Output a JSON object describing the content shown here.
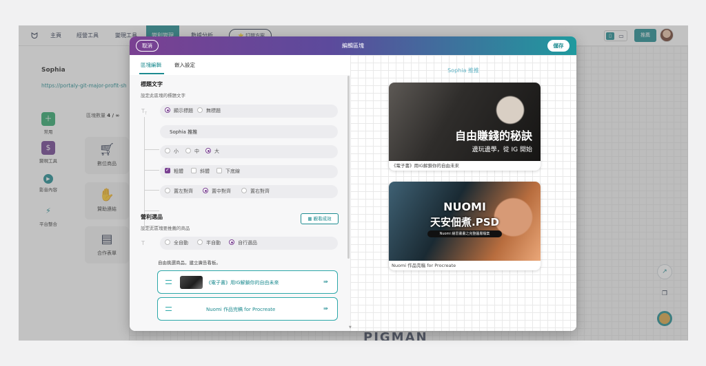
{
  "app": {
    "nav": [
      "主頁",
      "經營工具",
      "變現工具",
      "變利變現",
      "數據分析"
    ],
    "nav_active_index": 3,
    "nav_extra_button": "⭐ 訂閱方案",
    "publish_label": "推薦",
    "colors": {
      "accent": "#1b8a8f",
      "header_start": "#7a4192",
      "header_end": "#1f9a9e"
    }
  },
  "side": {
    "name": "Sophia",
    "link": "https://portaly-git-major-profit-sh",
    "block_count_label": "區塊數量",
    "block_count_value": "4 / ∞",
    "rail": [
      {
        "label": "常用",
        "icon": "plus-icon"
      },
      {
        "label": "變現工具",
        "icon": "dollar-icon"
      },
      {
        "label": "影音內容",
        "icon": "play-icon"
      },
      {
        "label": "平台整合",
        "icon": "bolt-icon"
      }
    ],
    "tiles": [
      {
        "label": "數位商品",
        "icon": "cart-icon"
      },
      {
        "label": "贊助連結",
        "icon": "donate-icon"
      },
      {
        "label": "合作表單",
        "icon": "form-icon"
      }
    ]
  },
  "modal": {
    "title": "編輯區塊",
    "cancel": "取消",
    "save": "儲存",
    "tabs": [
      "區塊編輯",
      "嵌入設定"
    ],
    "active_tab": 0,
    "title_section": {
      "heading": "標題文字",
      "desc": "設定此區塊的標題文字",
      "visibility": [
        "顯示標題",
        "無標題"
      ],
      "visibility_selected": 0,
      "title_value": "Sophia 推推",
      "sizes": [
        "小",
        "中",
        "大"
      ],
      "size_selected": 2,
      "styles": [
        "粗體",
        "斜體",
        "下底線"
      ],
      "styles_checked": [
        true,
        false,
        false
      ],
      "aligns": [
        "置左對齊",
        "置中對齊",
        "置右對齊"
      ],
      "align_selected": 1
    },
    "profit_section": {
      "heading": "營利選品",
      "desc": "設定此區塊要推薦的商品",
      "view_results": "觀看成效",
      "modes": [
        "全自動",
        "半自動",
        "自行選品"
      ],
      "mode_selected": 2,
      "curated_hint": "自由挑選商品，建立廣告看板。",
      "products": [
        {
          "name": "《電子書》用IG解鎖你的自由未來"
        },
        {
          "name": "Nuomi 作品完稿 for Procreate"
        }
      ]
    }
  },
  "preview": {
    "title": "Sophia 推推",
    "cards": [
      {
        "headline": "自由賺錢的秘訣",
        "subline": "邊玩邊學，從 IG 開始",
        "caption": "《電子書》用IG解鎖你的自由未來"
      },
      {
        "headline": "NUOMI",
        "subline": "天安佃煮.PSD",
        "chip": "Nuomi 繪習畫畫之完整圖層檔案",
        "caption": "Nuomi 作品完稿 for Procreate"
      }
    ]
  }
}
